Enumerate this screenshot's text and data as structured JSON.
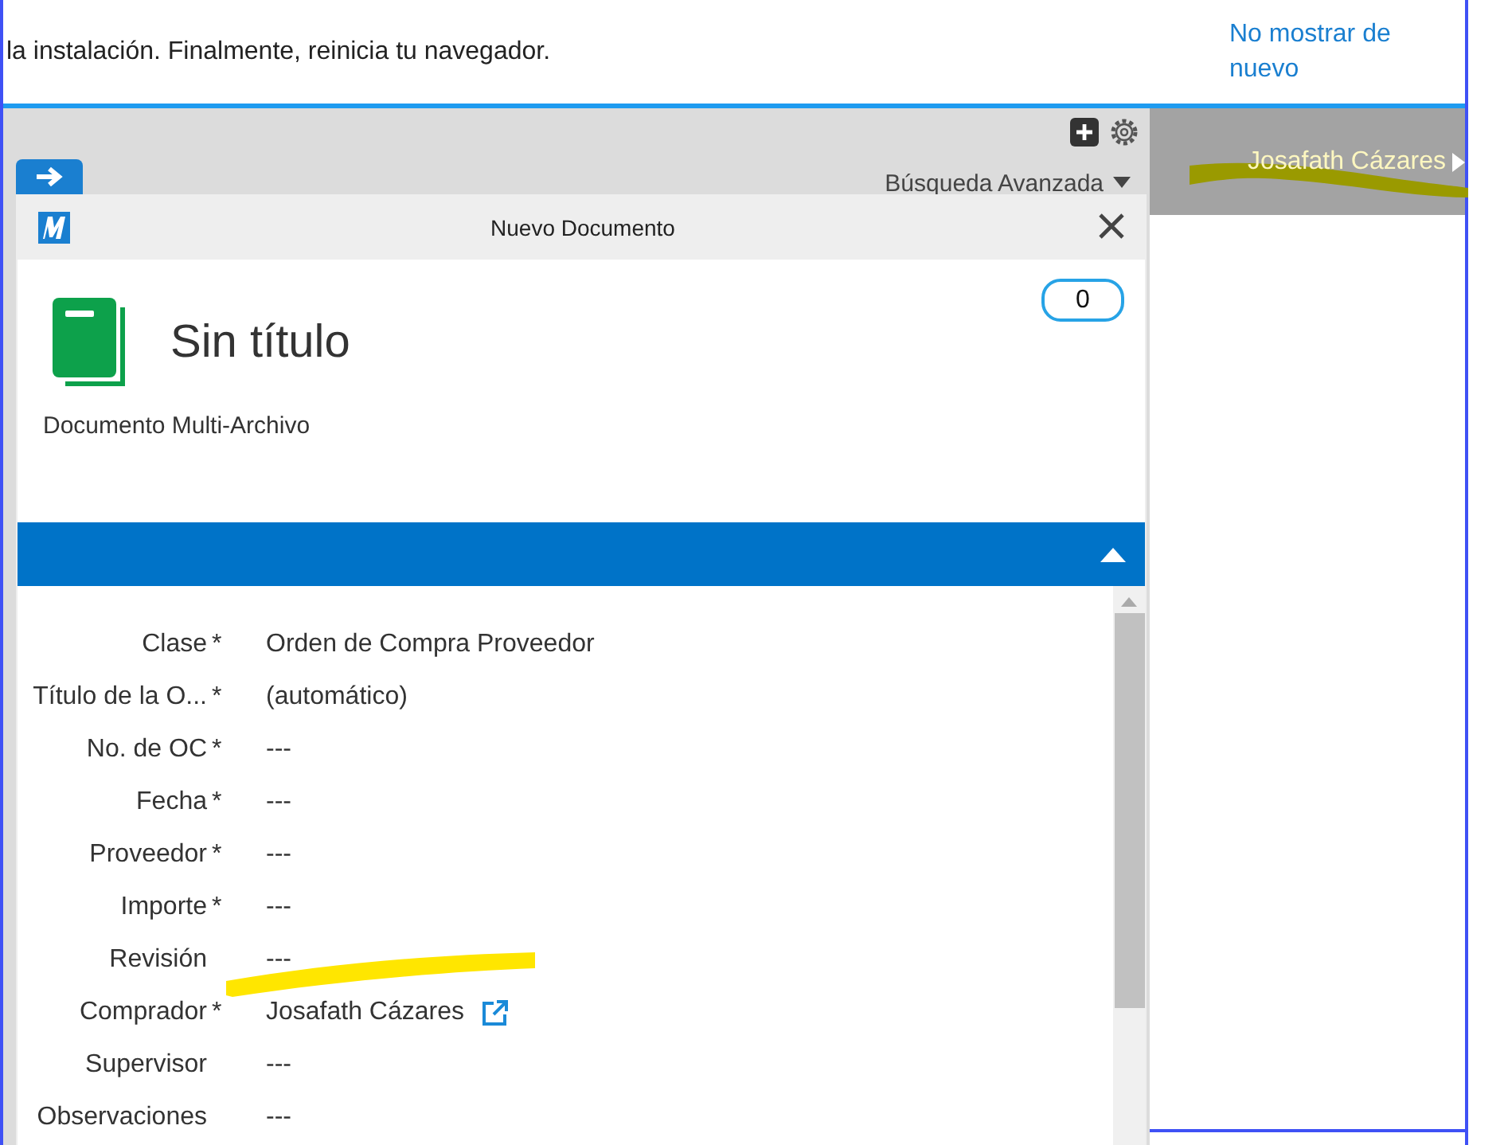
{
  "banner": {
    "message": "la instalación. Finalmente, reinicia tu navegador.",
    "dismiss_link": "No mostrar de nuevo"
  },
  "toolbar": {
    "advanced_search": "Búsqueda Avanzada"
  },
  "user": {
    "name": "Josafath Cázares"
  },
  "dialog": {
    "title": "Nuevo Documento",
    "document": {
      "title": "Sin título",
      "type": "Documento Multi-Archivo",
      "comment_count": "0"
    },
    "section": {
      "expanded": true
    },
    "fields": [
      {
        "label": "Clase",
        "required_mark": "*",
        "value": "Orden de Compra Proveedor",
        "kind": "text"
      },
      {
        "label": "Título de la O...",
        "required_mark": "*",
        "value": "(automático)",
        "kind": "text"
      },
      {
        "label": "No. de OC",
        "required_mark": "*",
        "value": "---",
        "kind": "text"
      },
      {
        "label": "Fecha",
        "required_mark": "*",
        "value": "---",
        "kind": "text"
      },
      {
        "label": "Proveedor",
        "required_mark": "*",
        "value": "---",
        "kind": "text"
      },
      {
        "label": "Importe",
        "required_mark": "*",
        "value": "---",
        "kind": "text"
      },
      {
        "label": "Revisión",
        "value": "---",
        "kind": "text"
      },
      {
        "label": "Comprador",
        "required_mark": "*",
        "value": "Josafath Cázares",
        "kind": "link"
      },
      {
        "label": "Supervisor",
        "value": "---",
        "kind": "text"
      },
      {
        "label": "Observaciones",
        "value": "---",
        "kind": "text"
      }
    ]
  }
}
